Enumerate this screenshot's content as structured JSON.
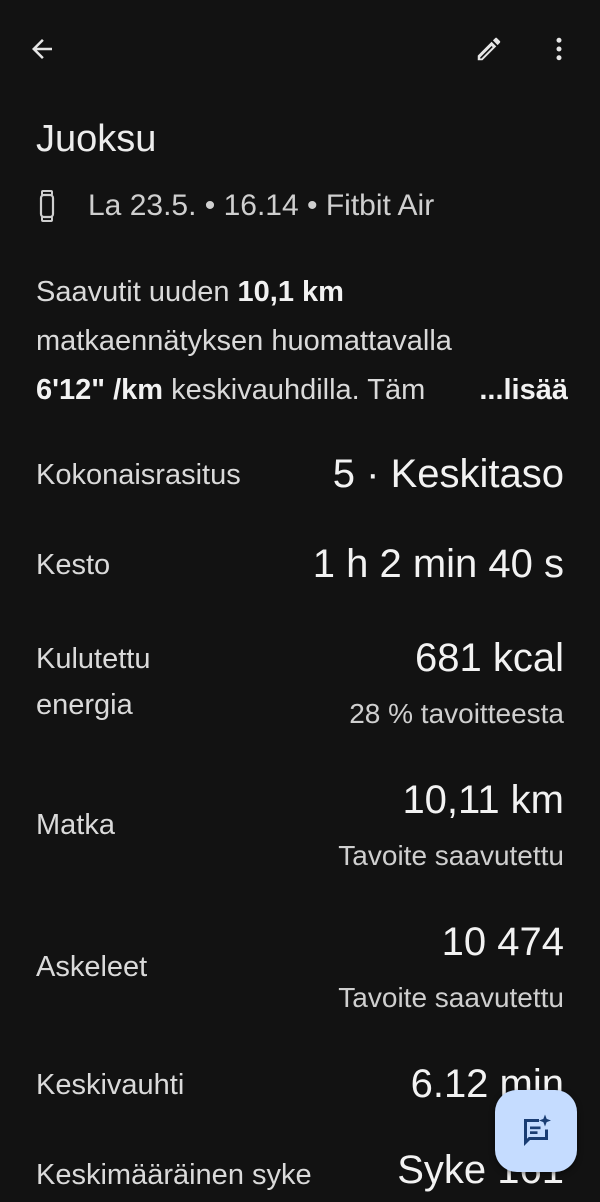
{
  "header": {
    "back_icon": "arrow-back-icon",
    "edit_icon": "pencil-icon",
    "more_icon": "more-vert-icon"
  },
  "activity": {
    "title": "Juoksu",
    "device_icon": "watch-icon",
    "meta": "La 23.5. • 16.14 • Fitbit Air"
  },
  "summary": {
    "line1_a": "Saavutit uuden ",
    "line1_b": "10,1 km",
    "line2": "matkaennätyksen huomattavalla",
    "line3_b": "6'12\" /km",
    "line3_a": " keskivauhdilla. Täm",
    "more": "...lisää"
  },
  "stats": {
    "load_label": "Kokonaisrasitus",
    "load_value": "5 · Keskitaso",
    "duration_label": "Kesto",
    "duration_value": "1 h 2 min 40 s",
    "energy_label_1": "Kulutettu",
    "energy_label_2": "energia",
    "energy_value": "681 kcal",
    "energy_sub": "28 % tavoitteesta",
    "distance_label": "Matka",
    "distance_value": "10,11 km",
    "distance_sub": "Tavoite saavutettu",
    "steps_label": "Askeleet",
    "steps_value": "10 474",
    "steps_sub": "Tavoite saavutettu",
    "pace_label": "Keskivauhti",
    "pace_value": "6.12 min",
    "hr_label": "Keskimääräinen syke",
    "hr_value": "Syke 161"
  },
  "fab": {
    "icon": "ai-chat-sparkle-icon"
  },
  "colors": {
    "background": "#121212",
    "fab": "#c5dcff",
    "fab_icon": "#1a3d73"
  }
}
